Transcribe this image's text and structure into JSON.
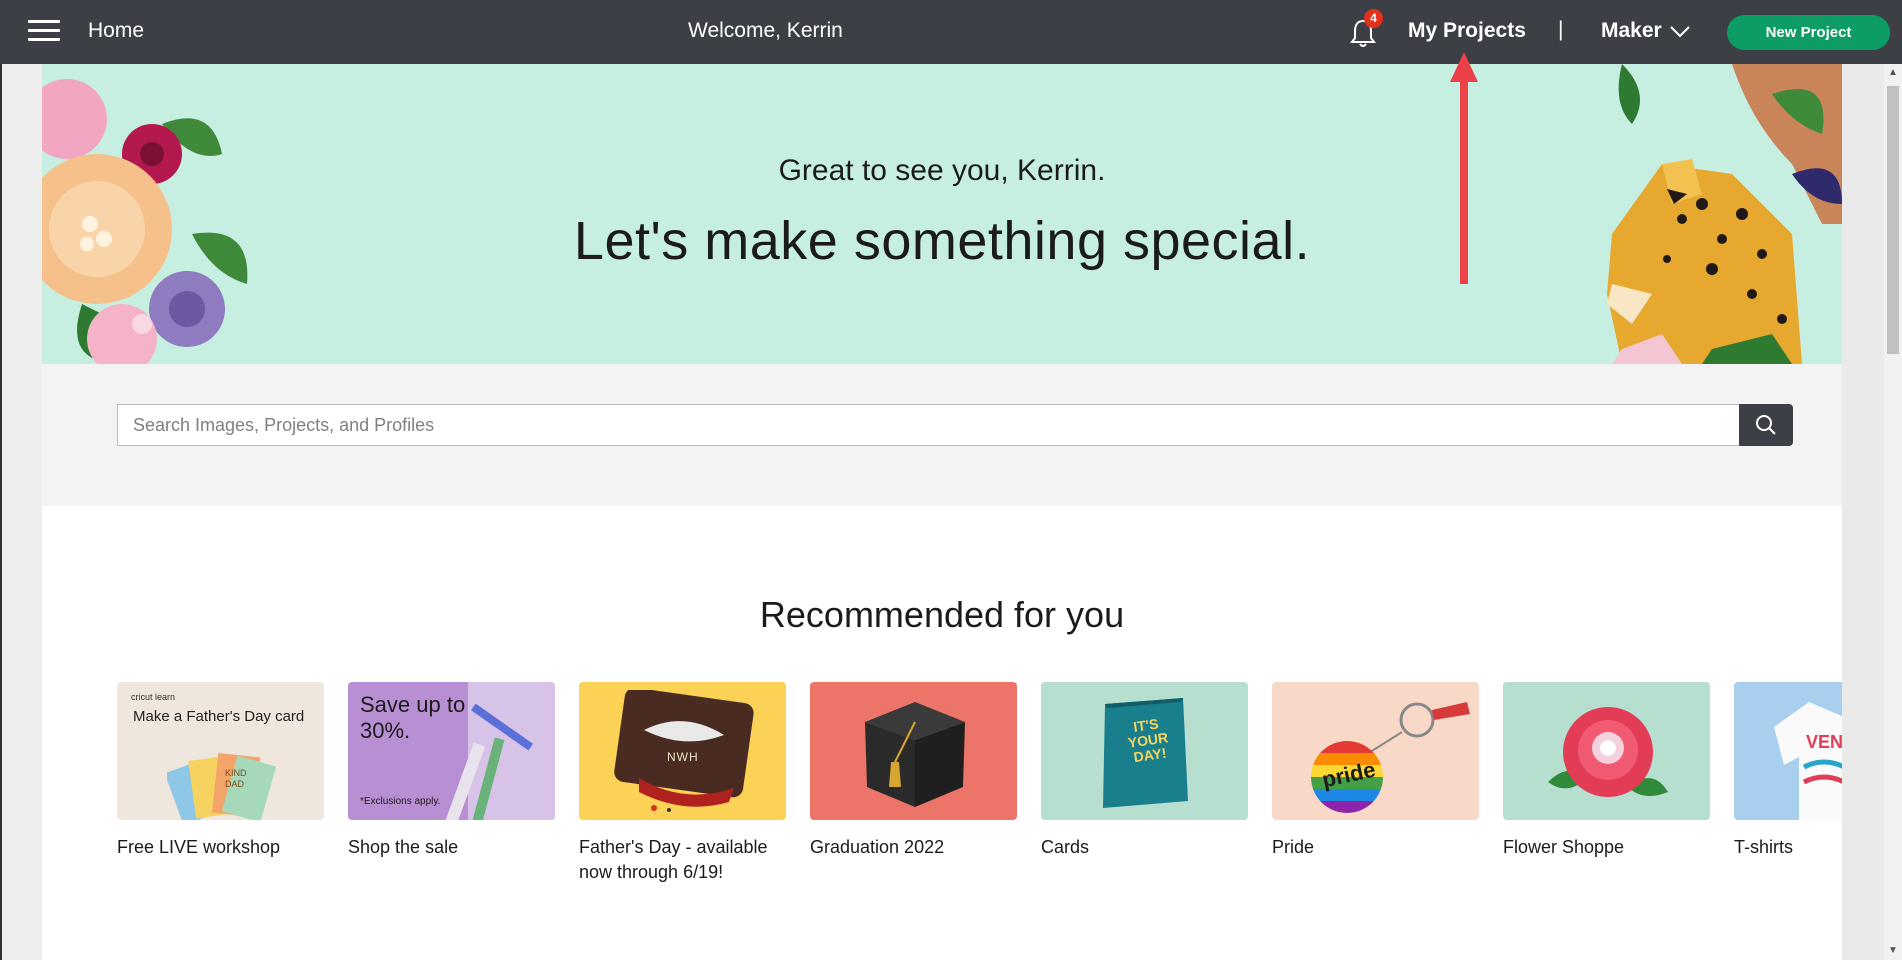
{
  "topbar": {
    "home_label": "Home",
    "welcome": "Welcome, Kerrin",
    "notification_count": "4",
    "my_projects": "My Projects",
    "divider": "|",
    "machine": "Maker",
    "new_project": "New Project"
  },
  "hero": {
    "greeting": "Great to see you, Kerrin.",
    "title": "Let's make something special."
  },
  "search": {
    "placeholder": "Search Images, Projects, and Profiles"
  },
  "recommended": {
    "heading": "Recommended for you",
    "cards": [
      {
        "caption": "Free LIVE workshop",
        "thumb_brand": "cricut learn",
        "thumb_text": "Make a Father's Day card",
        "thumb_card_text": "KIND DAD",
        "bg": "#efe6dd"
      },
      {
        "caption": "Shop the sale",
        "thumb_text": "Save up to 30%.",
        "thumb_note": "*Exclusions apply.",
        "bg": "#b98fd3"
      },
      {
        "caption": "Father's Day - available now through 6/19!",
        "thumb_text": "NWH",
        "bg": "#fbd156"
      },
      {
        "caption": "Graduation 2022",
        "bg": "#ec7469"
      },
      {
        "caption": "Cards",
        "thumb_text": "IT'S YOUR DAY!",
        "bg": "#b7dfd0"
      },
      {
        "caption": "Pride",
        "thumb_text": "pride",
        "bg": "#f8d9c8"
      },
      {
        "caption": "Flower Shoppe",
        "bg": "#b7dfd0"
      },
      {
        "caption": "T-shirts",
        "thumb_text": "VENI",
        "bg": "#a9cfef"
      }
    ]
  },
  "colors": {
    "topbar": "#3c4046",
    "accent_green": "#0c9c64",
    "hero_bg": "#c6efe2",
    "badge_red": "#e0321b",
    "annotation_arrow": "#ec4148"
  }
}
